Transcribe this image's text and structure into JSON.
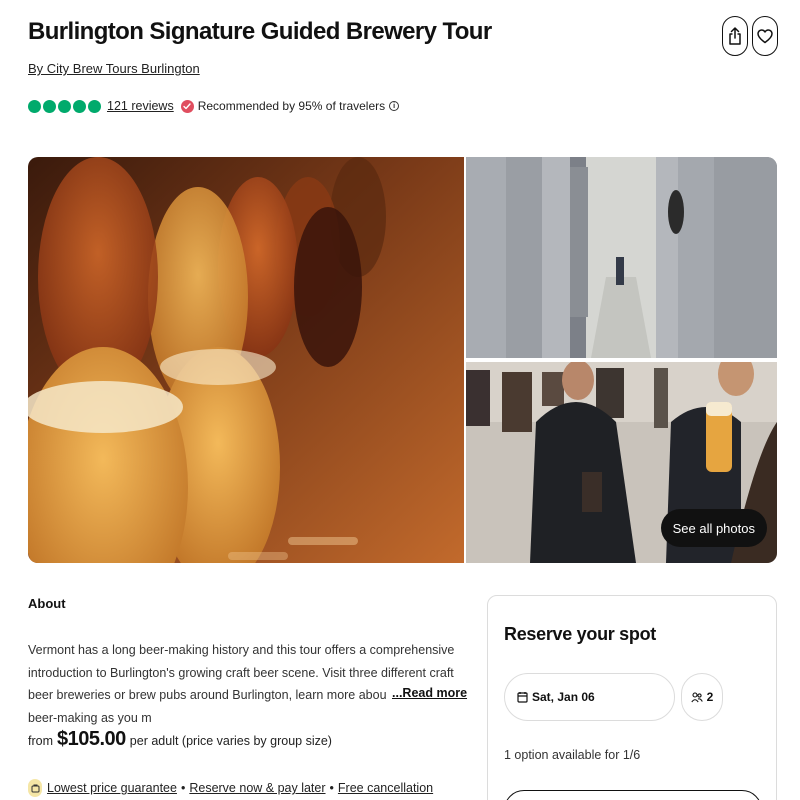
{
  "header": {
    "title": "Burlington Signature Guided Brewery Tour",
    "operator": "By City Brew Tours Burlington",
    "share_icon": "share-icon",
    "save_icon": "heart-icon"
  },
  "rating": {
    "bubbles_filled": 5,
    "bubbles_total": 5,
    "reviews": "121 reviews",
    "recommended": "Recommended by 95% of travelers",
    "accent": "#00aa6c"
  },
  "gallery": {
    "see_all": "See all photos"
  },
  "about": {
    "heading": "About",
    "description": "Vermont has a long beer-making history and this tour offers a comprehensive introduction to Burlington's growing craft beer scene. Visit three different craft beer breweries or brew pubs around Burlington, learn more about the art of beer-making as you m",
    "read_more": "...Read more"
  },
  "price": {
    "from": "from",
    "amount": "$105.00",
    "per": "per adult (price varies by group size)"
  },
  "benefits": {
    "lowest_price": "Lowest price guarantee",
    "separator": "•",
    "reserve_later": "Reserve now & pay later",
    "cancellation": "Free cancellation"
  },
  "reserve": {
    "title": "Reserve your spot",
    "date": "Sat, Jan 06",
    "guests": "2",
    "options": "1 option available for 1/6"
  }
}
